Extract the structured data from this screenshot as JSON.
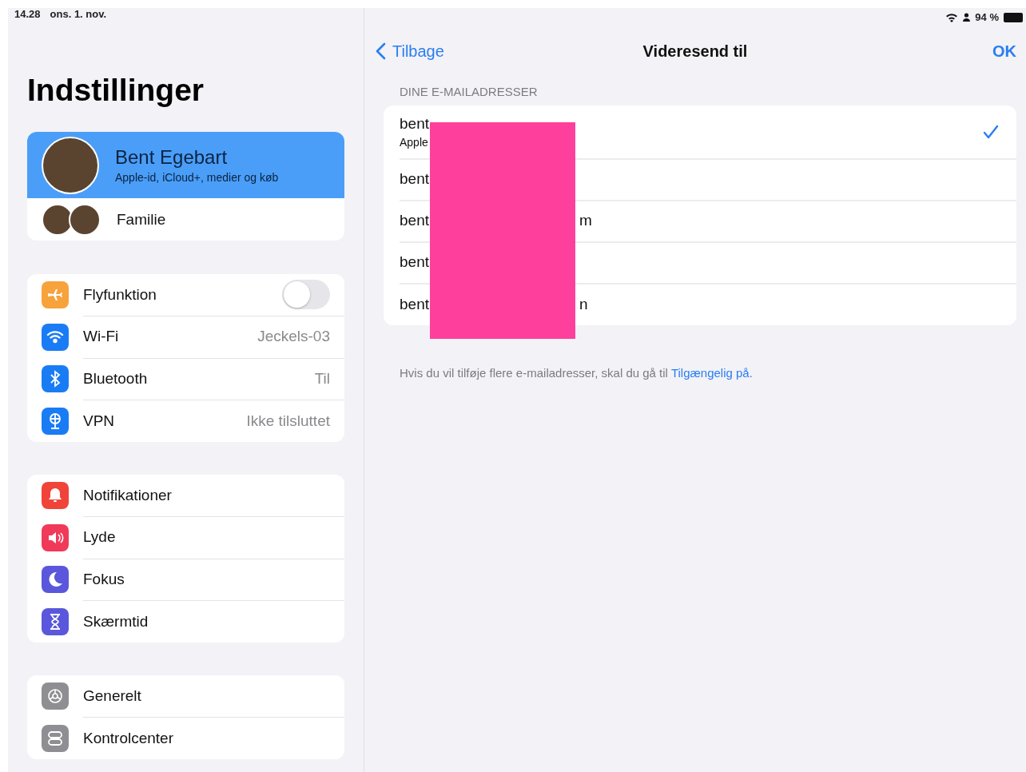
{
  "status_bar": {
    "time": "14.28",
    "date": "ons. 1. nov.",
    "battery": "94 %"
  },
  "sidebar": {
    "title": "Indstillinger",
    "profile": {
      "name": "Bent Egebart",
      "subtitle": "Apple-id, iCloud+, medier og køb",
      "selected": true
    },
    "family": {
      "label": "Familie",
      "selected": false
    },
    "groups": [
      [
        {
          "label": "Flyfunktion",
          "kind": "toggle",
          "on": false,
          "color": "#f7a23b",
          "selected": false
        },
        {
          "label": "Wi-Fi",
          "kind": "value",
          "value": "Jeckels-03",
          "color": "#1a7cf5",
          "selected": false
        },
        {
          "label": "Bluetooth",
          "kind": "value",
          "value": "Til",
          "color": "#1a7cf5",
          "selected": false
        },
        {
          "label": "VPN",
          "kind": "value",
          "value": "Ikke tilsluttet",
          "color": "#1a7cf5",
          "selected": false
        }
      ],
      [
        {
          "label": "Notifikationer",
          "kind": "link",
          "color": "#f0443a",
          "selected": false
        },
        {
          "label": "Lyde",
          "kind": "link",
          "color": "#f03a5a",
          "selected": false
        },
        {
          "label": "Fokus",
          "kind": "link",
          "color": "#5a57dc",
          "selected": false
        },
        {
          "label": "Skærmtid",
          "kind": "link",
          "color": "#5a57dc",
          "selected": false
        }
      ],
      [
        {
          "label": "Generelt",
          "kind": "link",
          "color": "#8e8e93",
          "selected": false
        },
        {
          "label": "Kontrolcenter",
          "kind": "link",
          "color": "#8e8e93",
          "selected": false
        }
      ]
    ]
  },
  "detail": {
    "back": "Tilbage",
    "title": "Videresend til",
    "done": "OK",
    "section_header": "DINE E-MAILADRESSER",
    "emails": [
      {
        "text": "bent",
        "subtitle": "Apple",
        "selected": true
      },
      {
        "text": "bent",
        "selected": false
      },
      {
        "text": "bent",
        "tail": "m",
        "selected": false
      },
      {
        "text": "bent",
        "selected": false
      },
      {
        "text": "bent",
        "tail": "n",
        "selected": false
      }
    ],
    "footer": "Hvis du vil tilføje flere e-mailadresser, skal du gå til",
    "footer_link": "Tilgængelig på."
  }
}
